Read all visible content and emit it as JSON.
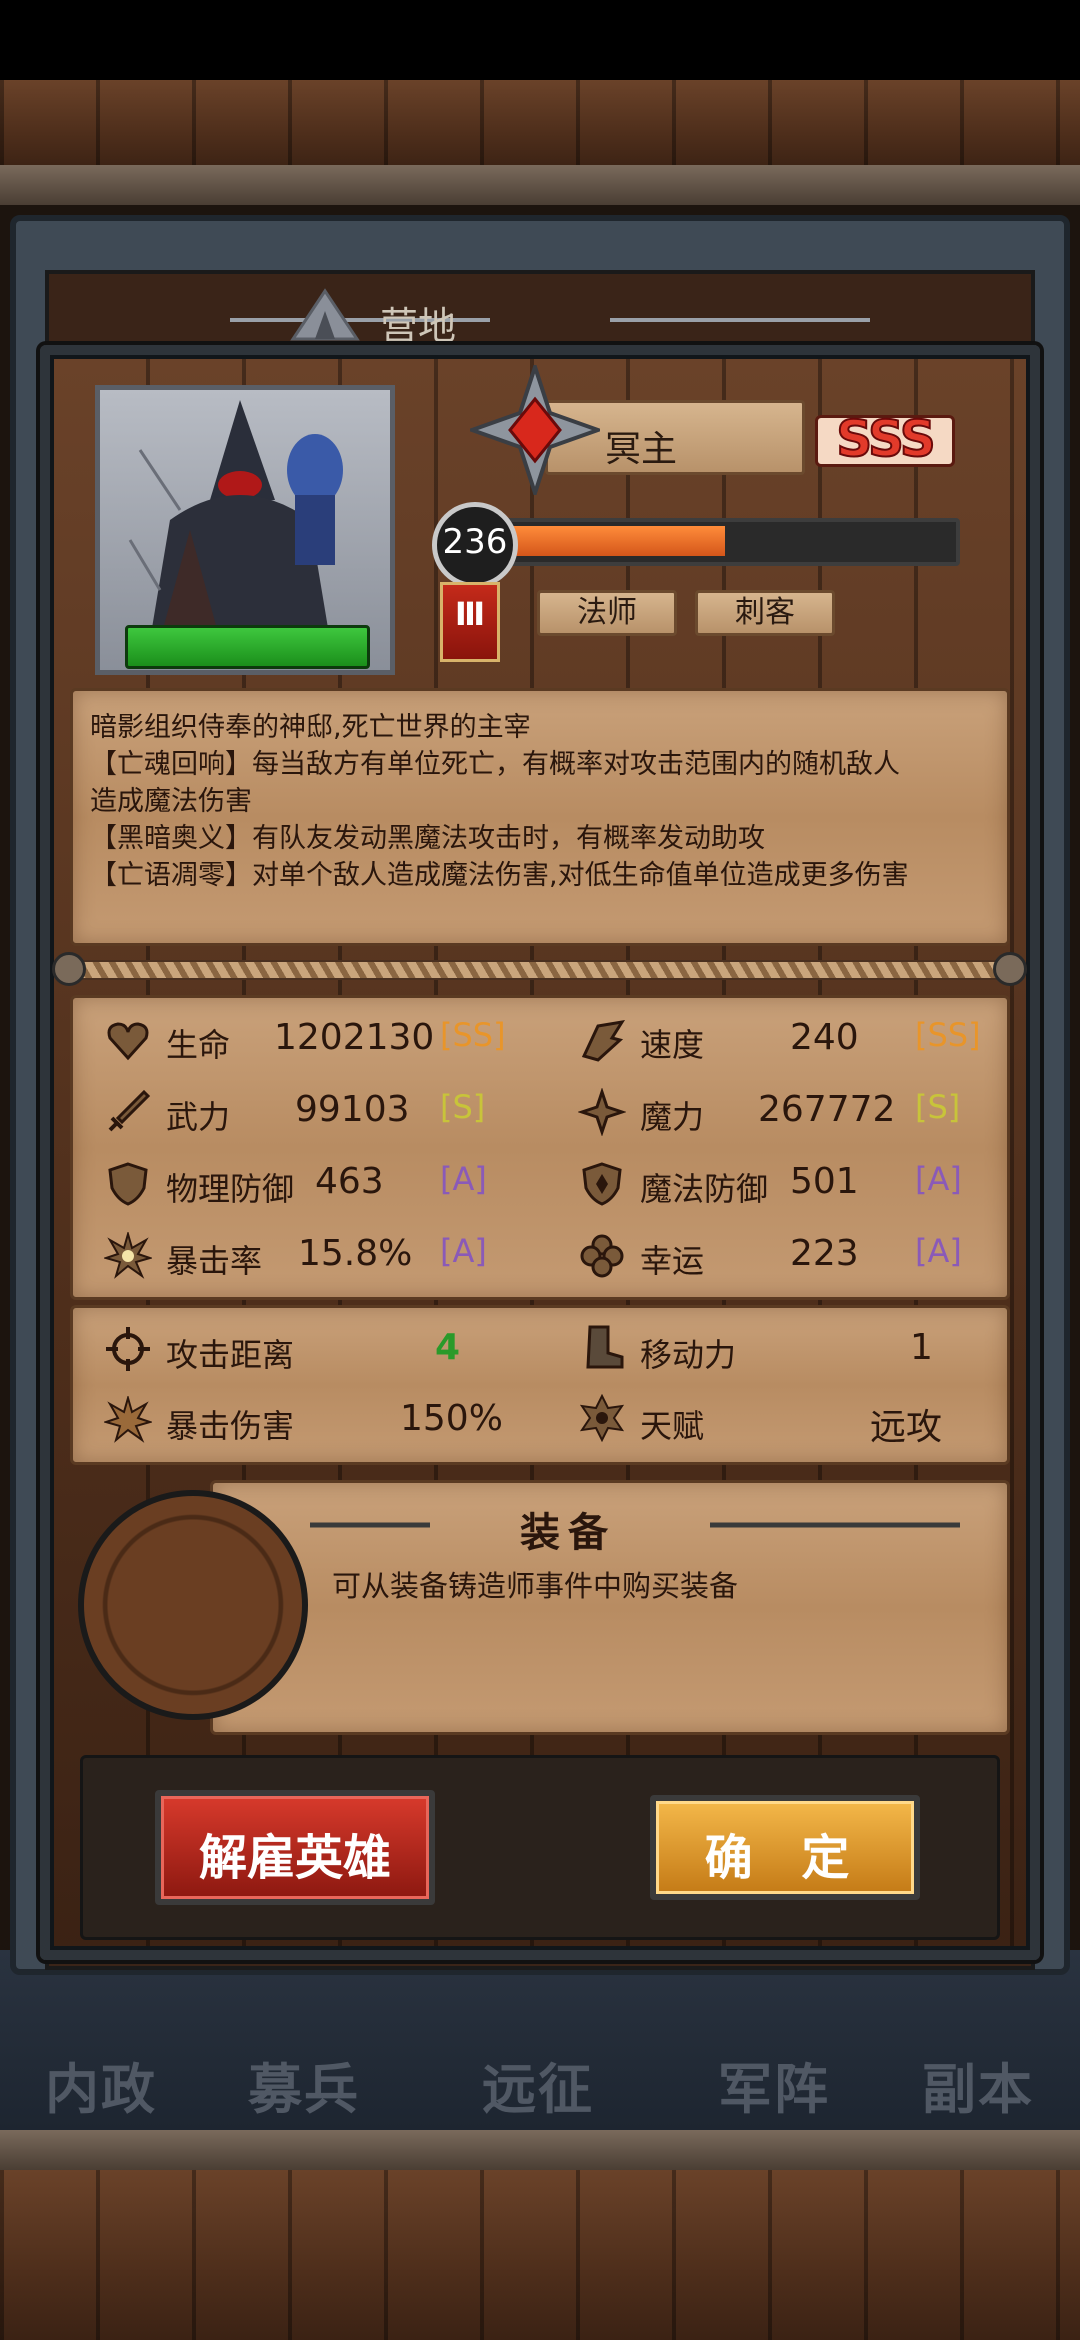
{
  "camp_title": "营地",
  "hero": {
    "name": "冥主",
    "rank": "SSS",
    "level": "236",
    "level_progress": 0.52,
    "tier": "Ⅲ",
    "classes": [
      "法师",
      "刺客"
    ],
    "portrait_hp_fraction": 1.0
  },
  "description": [
    "暗影组织侍奉的神邸,死亡世界的主宰",
    "【亡魂回响】每当敌方有单位死亡，有概率对攻击范围内的随机敌人",
    "造成魔法伤害",
    "【黑暗奥义】有队友发动黑魔法攻击时，有概率发动助攻",
    "【亡语凋零】对单个敌人造成魔法伤害,对低生命值单位造成更多伤害"
  ],
  "stats": {
    "hp": {
      "label": "生命",
      "value": "1202130",
      "grade": "[SS]"
    },
    "speed": {
      "label": "速度",
      "value": "240",
      "grade": "[SS]"
    },
    "attack": {
      "label": "武力",
      "value": "99103",
      "grade": "[S]"
    },
    "magic": {
      "label": "魔力",
      "value": "267772",
      "grade": "[S]"
    },
    "phys_def": {
      "label": "物理防御",
      "value": "463",
      "grade": "[A]"
    },
    "magic_def": {
      "label": "魔法防御",
      "value": "501",
      "grade": "[A]"
    },
    "crit_rate": {
      "label": "暴击率",
      "value": "15.8%",
      "grade": "[A]"
    },
    "luck": {
      "label": "幸运",
      "value": "223",
      "grade": "[A]"
    }
  },
  "extra": {
    "range": {
      "label": "攻击距离",
      "value": "4"
    },
    "move": {
      "label": "移动力",
      "value": "1"
    },
    "crit_dmg": {
      "label": "暴击伤害",
      "value": "150%"
    },
    "talent": {
      "label": "天赋",
      "value": "远攻"
    }
  },
  "equipment": {
    "title": "装备",
    "hint": "可从装备铸造师事件中购买装备"
  },
  "buttons": {
    "dismiss": "解雇英雄",
    "confirm": "确 定"
  },
  "nav": [
    "内政",
    "募兵",
    "远征",
    "军阵",
    "副本"
  ],
  "colors": {
    "grade_ss": "#e8952a",
    "grade_s": "#c8c43a",
    "grade_a": "#8a5ab8",
    "range_value": "#2a9a2a"
  }
}
